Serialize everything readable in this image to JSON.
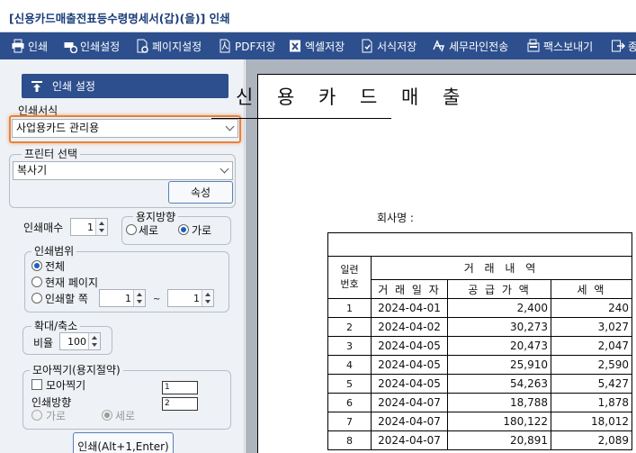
{
  "window": {
    "title": "[신용카드매출전표등수령명세서(갑)(을)] 인쇄"
  },
  "toolbar": {
    "items": [
      {
        "label": "인쇄",
        "icon": "printer-icon"
      },
      {
        "label": "인쇄설정",
        "icon": "print-settings-icon"
      },
      {
        "label": "페이지설정",
        "icon": "page-settings-icon"
      },
      {
        "label": "PDF저장",
        "icon": "pdf-icon"
      },
      {
        "label": "엑셀저장",
        "icon": "excel-icon"
      },
      {
        "label": "서식저장",
        "icon": "form-save-icon"
      },
      {
        "label": "세무라인전송",
        "icon": "tax-line-send-icon"
      },
      {
        "label": "팩스보내기",
        "icon": "fax-icon"
      },
      {
        "label": "종",
        "icon": "exit-icon"
      }
    ]
  },
  "panel": {
    "header": "인쇄 설정",
    "form_label": "인쇄서식",
    "form_value": "사업용카드 관리용",
    "printer_group": "프린터 선택",
    "printer_value": "복사기",
    "properties_button": "속성",
    "copies_label": "인쇄매수",
    "copies_value": "1",
    "orientation_group": "용지방향",
    "orientation_portrait": "세로",
    "orientation_landscape": "가로",
    "orientation_selected": "가로",
    "range_group": "인쇄범위",
    "range_all": "전체",
    "range_current": "현재 페이지",
    "range_pages": "인쇄할 쪽",
    "range_selected": "전체",
    "range_from": "1",
    "range_sep": "~",
    "range_to": "1",
    "zoom_group": "확대/축소",
    "zoom_label": "비율",
    "zoom_value": "100",
    "nup_group": "모아찍기(용지절약)",
    "nup_check": "모아찍기",
    "nup_checked": false,
    "nup_cols": "1",
    "nup_rows": "2",
    "nup_dir_label": "인쇄방향",
    "nup_dir_landscape": "가로",
    "nup_dir_portrait": "세로",
    "print_button": "인쇄(Alt+1,Enter)"
  },
  "document": {
    "title": "신 용 카 드 매 출",
    "company_label": "회사명 :",
    "header_no": "일련\n번호",
    "header_group": "거 래 내 역",
    "header_date": "거 래 일 자",
    "header_amount": "공 급 가 액",
    "header_tax": "세 액",
    "rows": [
      {
        "no": "1",
        "date": "2024-04-01",
        "amount": "2,400",
        "tax": "240"
      },
      {
        "no": "2",
        "date": "2024-04-02",
        "amount": "30,273",
        "tax": "3,027"
      },
      {
        "no": "3",
        "date": "2024-04-05",
        "amount": "20,473",
        "tax": "2,047"
      },
      {
        "no": "4",
        "date": "2024-04-05",
        "amount": "25,910",
        "tax": "2,590"
      },
      {
        "no": "5",
        "date": "2024-04-05",
        "amount": "54,263",
        "tax": "5,427"
      },
      {
        "no": "6",
        "date": "2024-04-07",
        "amount": "18,788",
        "tax": "1,878"
      },
      {
        "no": "7",
        "date": "2024-04-07",
        "amount": "180,122",
        "tax": "18,012"
      },
      {
        "no": "8",
        "date": "2024-04-07",
        "amount": "20,891",
        "tax": "2,089"
      }
    ]
  },
  "colors": {
    "toolbar": "#2d4f8e",
    "highlight": "#e8823a",
    "title_text": "#1a3d7a"
  }
}
